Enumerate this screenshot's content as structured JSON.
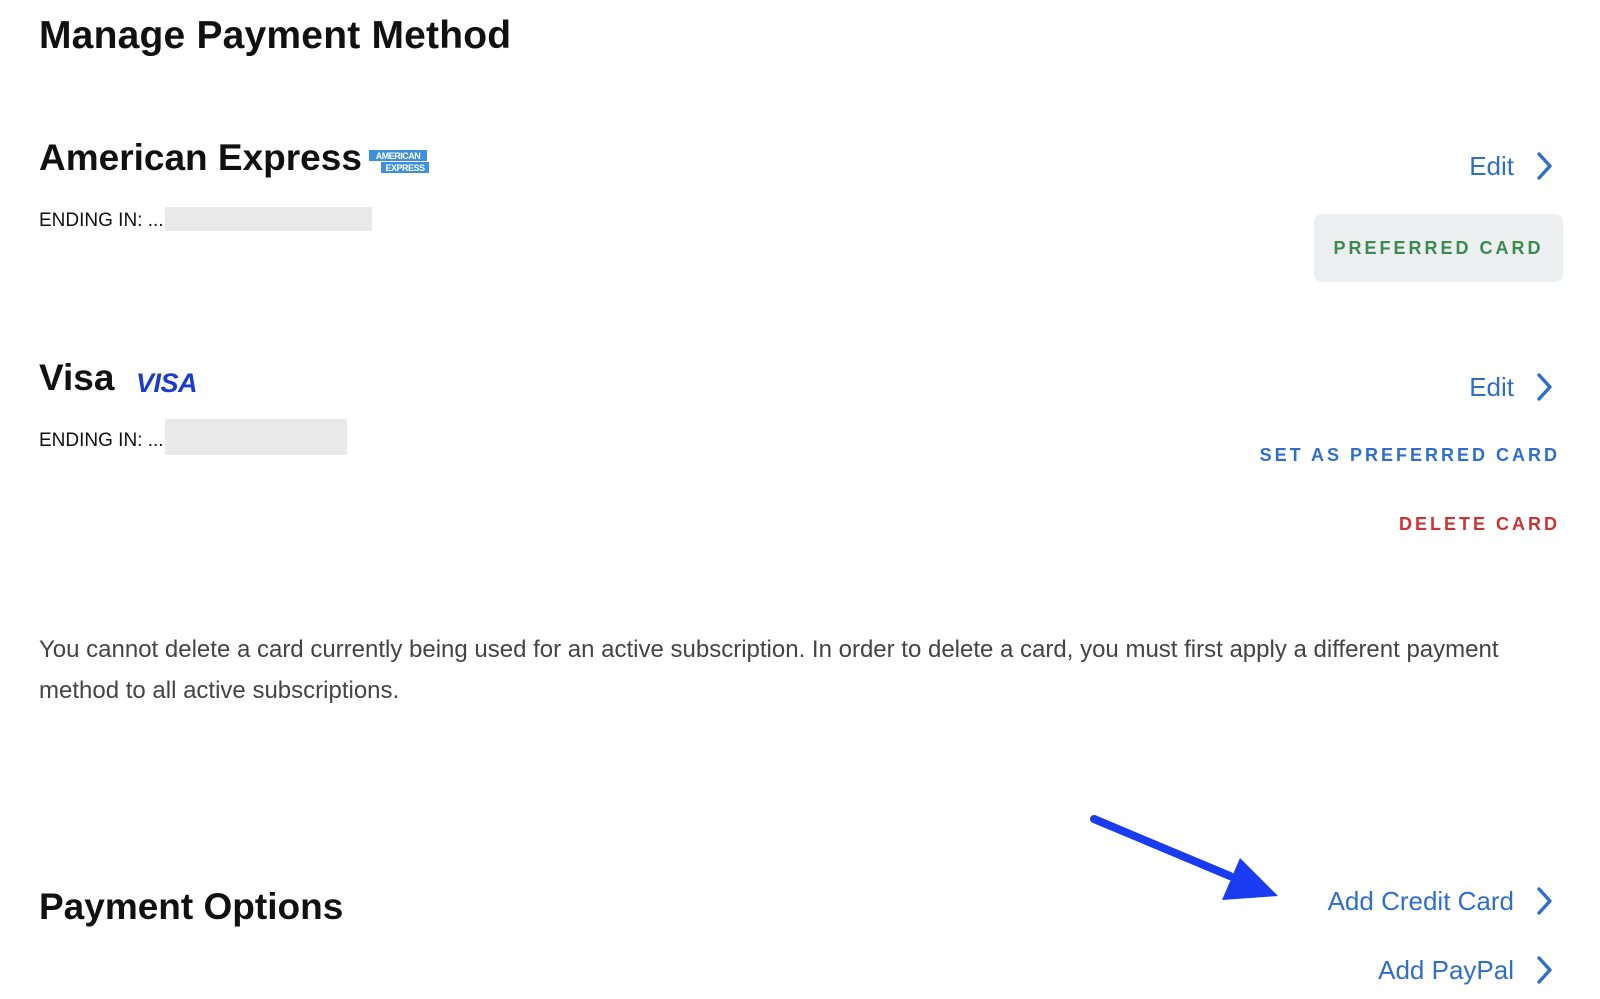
{
  "page": {
    "title": "Manage Payment Method"
  },
  "cards": [
    {
      "name": "American Express",
      "logo": "amex-logo",
      "ending_label": "ENDING IN: ...",
      "edit_label": "Edit",
      "status_badge": "PREFERRED CARD"
    },
    {
      "name": "Visa",
      "logo": "visa-logo",
      "logo_text": "VISA",
      "ending_label": "ENDING IN: ...",
      "edit_label": "Edit",
      "set_preferred_label": "SET AS PREFERRED CARD",
      "delete_label": "DELETE CARD"
    }
  ],
  "notice": "You cannot delete a card currently being used for an active subscription. In order to delete a card, you must first apply a different payment method to all active subscriptions.",
  "payment_options": {
    "title": "Payment Options",
    "add_credit_card_label": "Add Credit Card",
    "add_paypal_label": "Add PayPal"
  },
  "colors": {
    "link_blue": "#2f6fcb",
    "preferred_green": "#3c8a50",
    "delete_red": "#c93434",
    "badge_bg": "#eceef0",
    "annotation_arrow": "#1a3cf0"
  },
  "icons": {
    "chevron": "chevron-right-icon",
    "annotation": "arrow-annotation-icon"
  }
}
